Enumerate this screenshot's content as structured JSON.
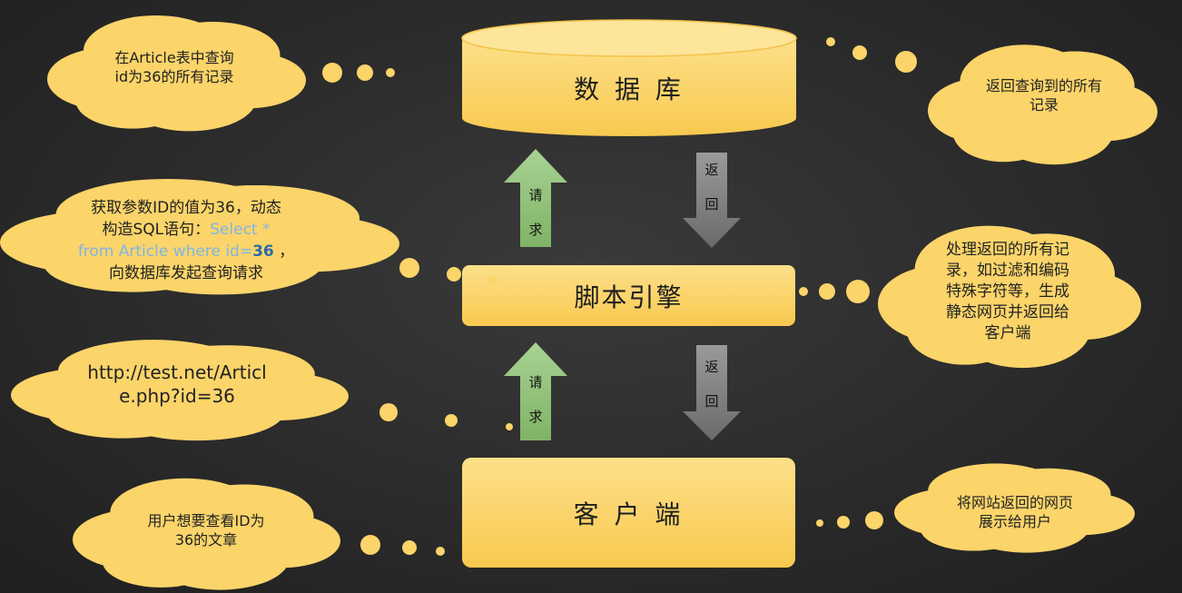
{
  "colors": {
    "background": "#2b2b2b",
    "node_fill": "#fbd46a",
    "cloud_fill": "#fbd46a",
    "request_arrow": "#8fc07a",
    "return_arrow": "#7d7d7d",
    "highlight_text": "#7fb6e6"
  },
  "nodes": {
    "database": "数 据 库",
    "script_engine": "脚本引擎",
    "client": "客 户 端"
  },
  "arrows": {
    "request_top": [
      "请",
      "求"
    ],
    "return_top": [
      "返",
      "回"
    ],
    "request_bottom": [
      "请",
      "求"
    ],
    "return_bottom": [
      "返",
      "回"
    ]
  },
  "clouds": {
    "query_article": [
      "在Article表中查询",
      "id为36的所有记录"
    ],
    "return_records": [
      "返回查询到的所有",
      "记录"
    ],
    "build_sql": {
      "line1": "获取参数ID的值为36，动态",
      "line2_prefix": "构造SQL语句：",
      "line2_code": "Select *",
      "line3_code": "from Article where id=",
      "line3_value": "36",
      "line3_suffix": " ，",
      "line4": "向数据库发起查询请求"
    },
    "process_records": [
      "处理返回的所有记",
      "录，如过滤和编码",
      "特殊字符等，生成",
      "静态网页并返回给",
      "客户端"
    ],
    "url": [
      "http://test.net/Articl",
      "e.php?id=36"
    ],
    "user_wants": [
      "用户想要查看ID为",
      "36的文章"
    ],
    "show_page": [
      "将网站返回的网页",
      "展示给用户"
    ]
  }
}
